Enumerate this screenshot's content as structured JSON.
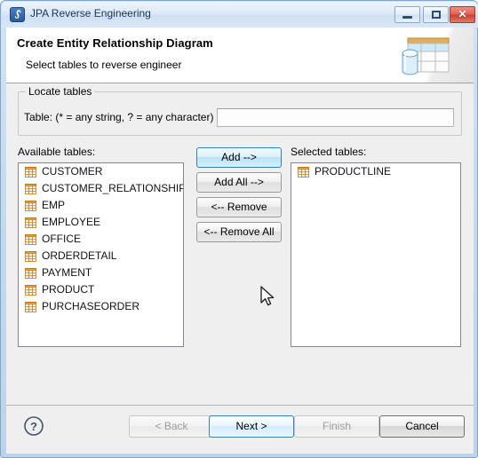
{
  "window": {
    "title": "JPA Reverse Engineering",
    "icon": "jpa-icon",
    "controls": {
      "minimize": "minimize-button",
      "maximize": "maximize-button",
      "close_glyph": "✕"
    }
  },
  "header": {
    "title": "Create Entity Relationship Diagram",
    "subtitle": "Select tables to reverse engineer",
    "graphic": "database-table-banner-icon"
  },
  "locate_group": {
    "legend": "Locate tables",
    "field_label": "Table: (* = any string, ? = any character)",
    "field_value": "",
    "field_placeholder": ""
  },
  "available": {
    "label": "Available tables:",
    "items": [
      "CUSTOMER",
      "CUSTOMER_RELATIONSHIP",
      "EMP",
      "EMPLOYEE",
      "OFFICE",
      "ORDERDETAIL",
      "PAYMENT",
      "PRODUCT",
      "PURCHASEORDER"
    ]
  },
  "selected": {
    "label": "Selected tables:",
    "items": [
      "PRODUCTLINE"
    ]
  },
  "transfer_buttons": {
    "add": "Add -->",
    "add_all": "Add All -->",
    "remove": "<-- Remove",
    "remove_all": "<-- Remove All"
  },
  "footer": {
    "help": "help-button",
    "back": "< Back",
    "next": "Next >",
    "finish": "Finish",
    "cancel": "Cancel"
  },
  "colors": {
    "window_border": "#7ea7cc",
    "body_background": "#efefef",
    "highlight_blue": "#3c7fb1",
    "table_icon_header": "#e8a33d",
    "close_button_red": "#c93e2e"
  }
}
